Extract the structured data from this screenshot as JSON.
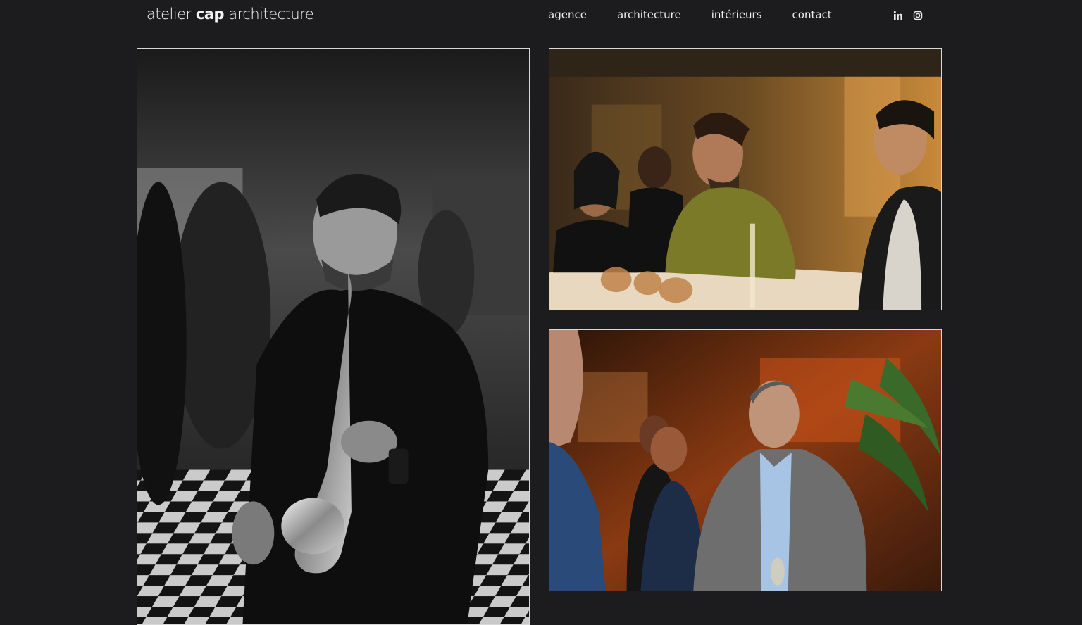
{
  "header": {
    "logo": {
      "part1": "atelier ",
      "part2": "cap",
      "part3": " architecture"
    },
    "nav": [
      {
        "label": "agence"
      },
      {
        "label": "architecture"
      },
      {
        "label": "intérieurs"
      },
      {
        "label": "contact"
      }
    ],
    "social": [
      {
        "icon": "linkedin-icon",
        "label": "in"
      },
      {
        "icon": "instagram-icon"
      }
    ]
  },
  "gallery": [
    {
      "name": "saxophonist-photo",
      "tone": "black-and-white"
    },
    {
      "name": "bar-conversation-photo",
      "tone": "warm"
    },
    {
      "name": "lounge-guests-photo",
      "tone": "warm-orange"
    }
  ],
  "colors": {
    "background": "#1c1c1e",
    "text": "#f0f0f0",
    "photo_border": "#d8d8d8"
  }
}
